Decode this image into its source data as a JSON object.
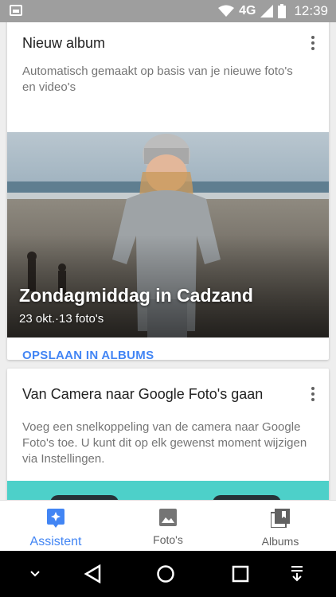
{
  "statusbar": {
    "network": "4G",
    "time": "12:39",
    "icons": [
      "image-notification-icon",
      "wifi-icon",
      "signal-icon",
      "battery-icon"
    ]
  },
  "card1": {
    "title": "Nieuw album",
    "description": "Automatisch gemaakt op basis van je nieuwe foto's en video's",
    "photo_title": "Zondagmiddag in Cadzand",
    "photo_subtitle": "23 okt.·13 foto's",
    "action": "OPSLAAN IN ALBUMS"
  },
  "card2": {
    "title": "Van Camera naar Google Foto's gaan",
    "description": "Voeg een snelkoppeling van de camera naar Google Foto's toe. U kunt dit op elk gewenst moment wijzigen via Instellingen."
  },
  "bottom_nav": {
    "items": [
      {
        "label": "Assistent",
        "icon": "assistant-icon",
        "active": true
      },
      {
        "label": "Foto's",
        "icon": "photos-icon",
        "active": false
      },
      {
        "label": "Albums",
        "icon": "albums-icon",
        "active": false
      }
    ]
  },
  "colors": {
    "accent": "#4285f4",
    "teal": "#4dd0c9",
    "statusbar": "#9e9e9e"
  }
}
